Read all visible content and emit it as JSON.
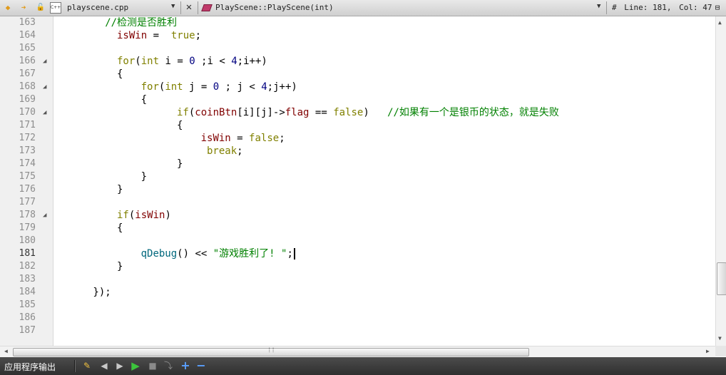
{
  "toolbar": {
    "file_name": "playscene.cpp",
    "file_icon_label": "C++",
    "symbol": "PlayScene::PlayScene(int)",
    "hash": "#",
    "line_label": "Line: 181,",
    "col_label": "Col: 47"
  },
  "editor": {
    "current_line": 181,
    "caret_col": 47
  },
  "code": [
    {
      "n": "163",
      "ind": "        ",
      "parts": [
        [
          "cm",
          "//检测是否胜利"
        ]
      ]
    },
    {
      "n": "164",
      "ind": "          ",
      "parts": [
        [
          "mb",
          "isWin"
        ],
        [
          "p",
          " =  "
        ],
        [
          "kw",
          "true"
        ],
        [
          "p",
          ";"
        ]
      ]
    },
    {
      "n": "165",
      "ind": "",
      "parts": []
    },
    {
      "n": "166",
      "ind": "          ",
      "fold": true,
      "parts": [
        [
          "kw",
          "for"
        ],
        [
          "p",
          "("
        ],
        [
          "kw",
          "int"
        ],
        [
          "p",
          " i = "
        ],
        [
          "nm",
          "0"
        ],
        [
          "p",
          " ;i < "
        ],
        [
          "nm",
          "4"
        ],
        [
          "p",
          ";i++)"
        ]
      ]
    },
    {
      "n": "167",
      "ind": "          ",
      "parts": [
        [
          "p",
          "{"
        ]
      ]
    },
    {
      "n": "168",
      "ind": "              ",
      "fold": true,
      "parts": [
        [
          "kw",
          "for"
        ],
        [
          "p",
          "("
        ],
        [
          "kw",
          "int"
        ],
        [
          "p",
          " j = "
        ],
        [
          "nm",
          "0"
        ],
        [
          "p",
          " ; j < "
        ],
        [
          "nm",
          "4"
        ],
        [
          "p",
          ";j++)"
        ]
      ]
    },
    {
      "n": "169",
      "ind": "              ",
      "parts": [
        [
          "p",
          "{"
        ]
      ]
    },
    {
      "n": "170",
      "ind": "                    ",
      "fold": true,
      "parts": [
        [
          "kw",
          "if"
        ],
        [
          "p",
          "("
        ],
        [
          "mb",
          "coinBtn"
        ],
        [
          "p",
          "[i][j]->"
        ],
        [
          "mb",
          "flag"
        ],
        [
          "p",
          " == "
        ],
        [
          "kw",
          "false"
        ],
        [
          "p",
          ")   "
        ],
        [
          "cm",
          "//如果有一个是银币的状态，就是失败"
        ]
      ]
    },
    {
      "n": "171",
      "ind": "                    ",
      "parts": [
        [
          "p",
          "{"
        ]
      ]
    },
    {
      "n": "172",
      "ind": "                        ",
      "parts": [
        [
          "mb",
          "isWin"
        ],
        [
          "p",
          " = "
        ],
        [
          "kw",
          "false"
        ],
        [
          "p",
          ";"
        ]
      ]
    },
    {
      "n": "173",
      "ind": "                         ",
      "parts": [
        [
          "kw",
          "break"
        ],
        [
          "p",
          ";"
        ]
      ]
    },
    {
      "n": "174",
      "ind": "                    ",
      "parts": [
        [
          "p",
          "}"
        ]
      ]
    },
    {
      "n": "175",
      "ind": "              ",
      "parts": [
        [
          "p",
          "}"
        ]
      ]
    },
    {
      "n": "176",
      "ind": "          ",
      "parts": [
        [
          "p",
          "}"
        ]
      ]
    },
    {
      "n": "177",
      "ind": "",
      "parts": []
    },
    {
      "n": "178",
      "ind": "          ",
      "fold": true,
      "parts": [
        [
          "kw",
          "if"
        ],
        [
          "p",
          "("
        ],
        [
          "mb",
          "isWin"
        ],
        [
          "p",
          ")"
        ]
      ]
    },
    {
      "n": "179",
      "ind": "          ",
      "parts": [
        [
          "p",
          "{"
        ]
      ]
    },
    {
      "n": "180",
      "ind": "",
      "parts": []
    },
    {
      "n": "181",
      "ind": "              ",
      "cur": true,
      "parts": [
        [
          "fn",
          "qDebug"
        ],
        [
          "p",
          "() << "
        ],
        [
          "st",
          "\"游戏胜利了! \""
        ],
        [
          "p",
          ";"
        ]
      ]
    },
    {
      "n": "182",
      "ind": "          ",
      "parts": [
        [
          "p",
          "}"
        ]
      ]
    },
    {
      "n": "183",
      "ind": "",
      "parts": []
    },
    {
      "n": "184",
      "ind": "      ",
      "parts": [
        [
          "p",
          "});"
        ]
      ]
    },
    {
      "n": "185",
      "ind": "",
      "parts": []
    },
    {
      "n": "186",
      "ind": "",
      "parts": []
    },
    {
      "n": "187",
      "ind": "",
      "parts": []
    }
  ],
  "output_pane": {
    "title": "应用程序输出"
  }
}
